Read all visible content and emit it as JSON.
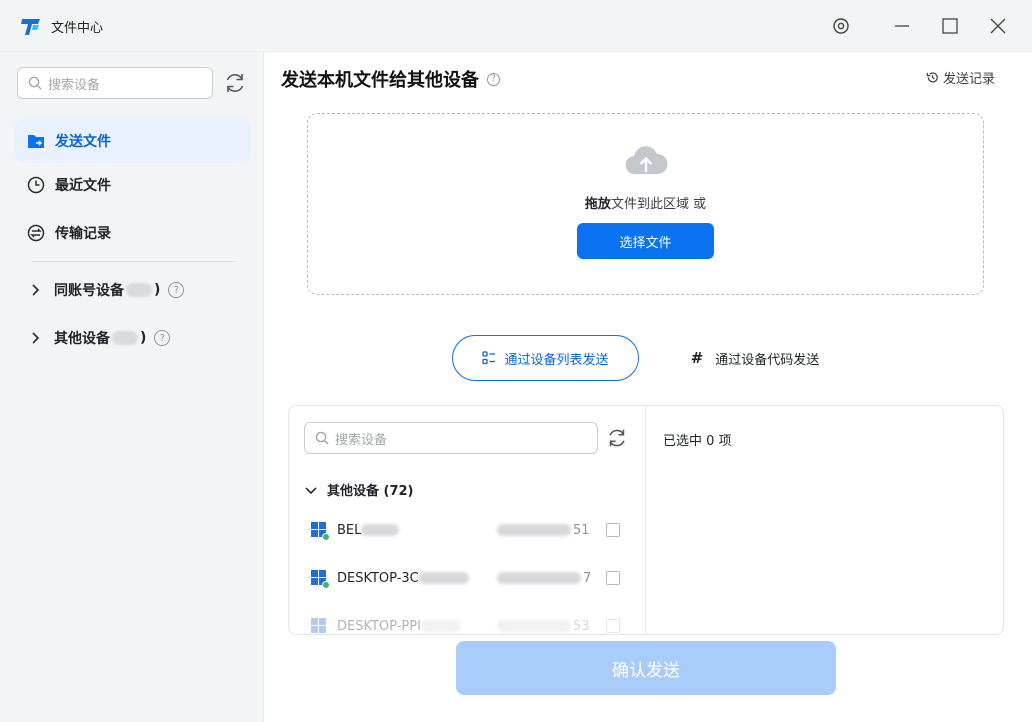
{
  "window": {
    "title": "文件中心"
  },
  "sidebar": {
    "search_placeholder": "搜索设备",
    "nav": [
      {
        "label": "发送文件",
        "icon": "send-file-icon",
        "active": true
      },
      {
        "label": "最近文件",
        "icon": "clock-icon",
        "active": false
      },
      {
        "label": "传输记录",
        "icon": "transfer-icon",
        "active": false
      }
    ],
    "groups": [
      {
        "label": "同账号设备",
        "suffix": ")"
      },
      {
        "label": "其他设备",
        "suffix": ")"
      }
    ],
    "help_glyph": "?"
  },
  "main": {
    "title": "发送本机文件给其他设备",
    "help_glyph": "?",
    "history_label": "发送记录",
    "dropzone": {
      "drag_bold": "拖放",
      "drag_rest": "文件到此区域 或",
      "select_button": "选择文件"
    },
    "tabs": [
      {
        "label": "通过设备列表发送",
        "icon": "list-icon",
        "active": true
      },
      {
        "label": "通过设备代码发送",
        "icon": "hash-icon",
        "glyph": "#",
        "active": false
      }
    ],
    "device_panel": {
      "search_placeholder": "搜索设备",
      "selected_text": "已选中 0 项",
      "group_label": "其他设备 (72)",
      "devices": [
        {
          "name": "BEL",
          "id_prefix": "",
          "id_suffix": "51",
          "online": true
        },
        {
          "name": "DESKTOP-3C",
          "id_prefix": "",
          "id_suffix": "7",
          "online": true
        },
        {
          "name": "DESKTOP-PPI",
          "id_prefix": "",
          "id_suffix": "53",
          "online": false
        }
      ]
    },
    "confirm_button": "确认发送"
  },
  "colors": {
    "accent": "#0b73f0",
    "accent_light": "#a9cdfa",
    "online": "#3cb371"
  }
}
